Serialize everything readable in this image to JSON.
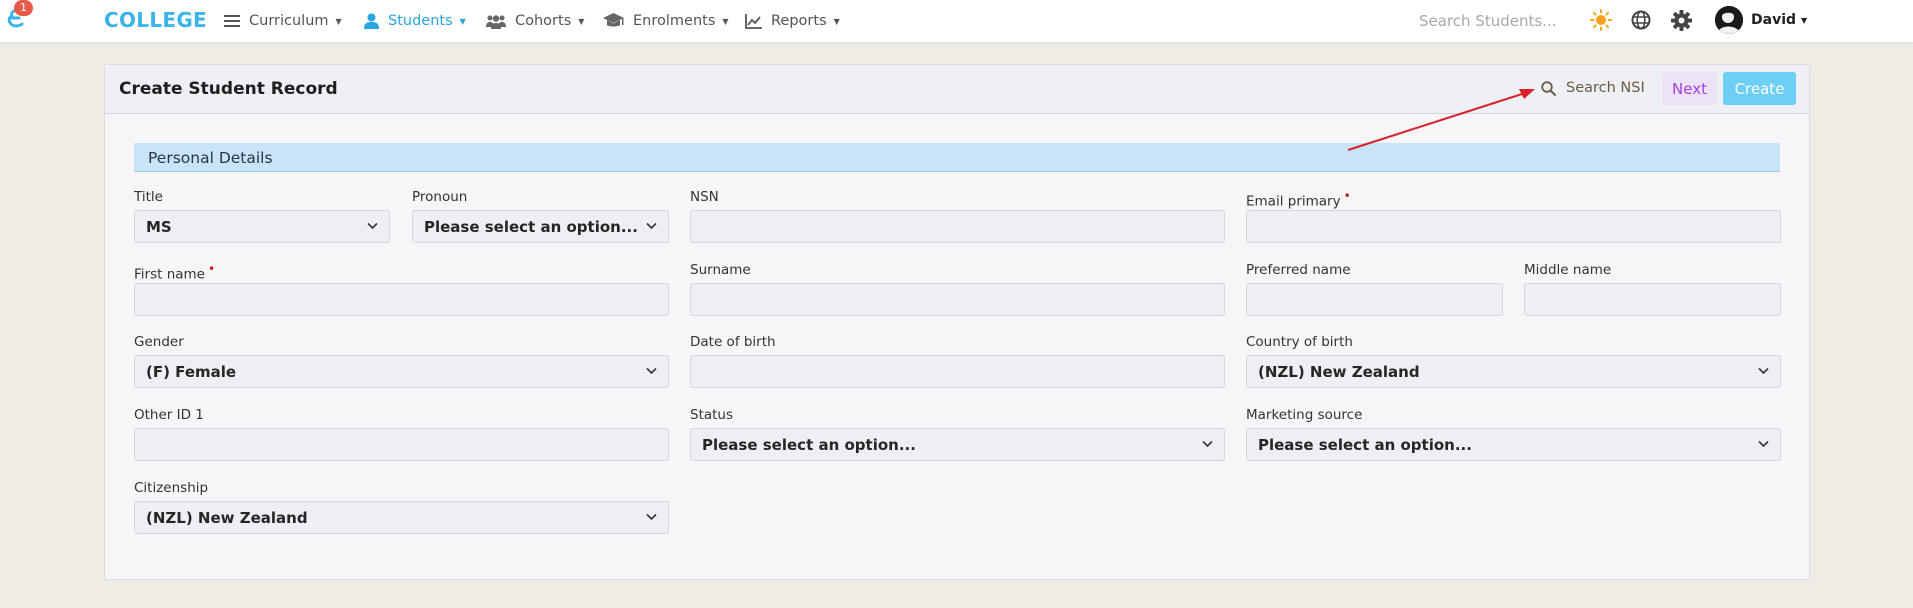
{
  "nav": {
    "notification_count": "1",
    "brand": "COLLEGE",
    "items": [
      {
        "label": "Curriculum"
      },
      {
        "label": "Students"
      },
      {
        "label": "Cohorts"
      },
      {
        "label": "Enrolments"
      },
      {
        "label": "Reports"
      }
    ],
    "search_placeholder": "Search Students...",
    "user_name": "David",
    "accent_color": "#2aa4e2"
  },
  "card": {
    "title": "Create Student Record",
    "search_nsi_label": "Search NSI",
    "next_label": "Next",
    "create_label": "Create"
  },
  "section": {
    "title": "Personal Details"
  },
  "form": {
    "title": {
      "label": "Title",
      "value": "MS"
    },
    "pronoun": {
      "label": "Pronoun",
      "value": "Please select an option..."
    },
    "nsn": {
      "label": "NSN",
      "value": ""
    },
    "email_primary": {
      "label": "Email primary",
      "value": ""
    },
    "first_name": {
      "label": "First name",
      "value": ""
    },
    "surname": {
      "label": "Surname",
      "value": ""
    },
    "preferred_name": {
      "label": "Preferred name",
      "value": ""
    },
    "middle_name": {
      "label": "Middle name",
      "value": ""
    },
    "gender": {
      "label": "Gender",
      "value": "(F) Female"
    },
    "date_of_birth": {
      "label": "Date of birth",
      "value": ""
    },
    "country_of_birth": {
      "label": "Country of birth",
      "value": "(NZL) New Zealand"
    },
    "other_id_1": {
      "label": "Other ID 1",
      "value": ""
    },
    "status": {
      "label": "Status",
      "value": "Please select an option..."
    },
    "marketing_source": {
      "label": "Marketing source",
      "value": "Please select an option..."
    },
    "citizenship": {
      "label": "Citizenship",
      "value": "(NZL) New Zealand"
    }
  },
  "required_marker": "•",
  "annotation_color": "#d9212a"
}
